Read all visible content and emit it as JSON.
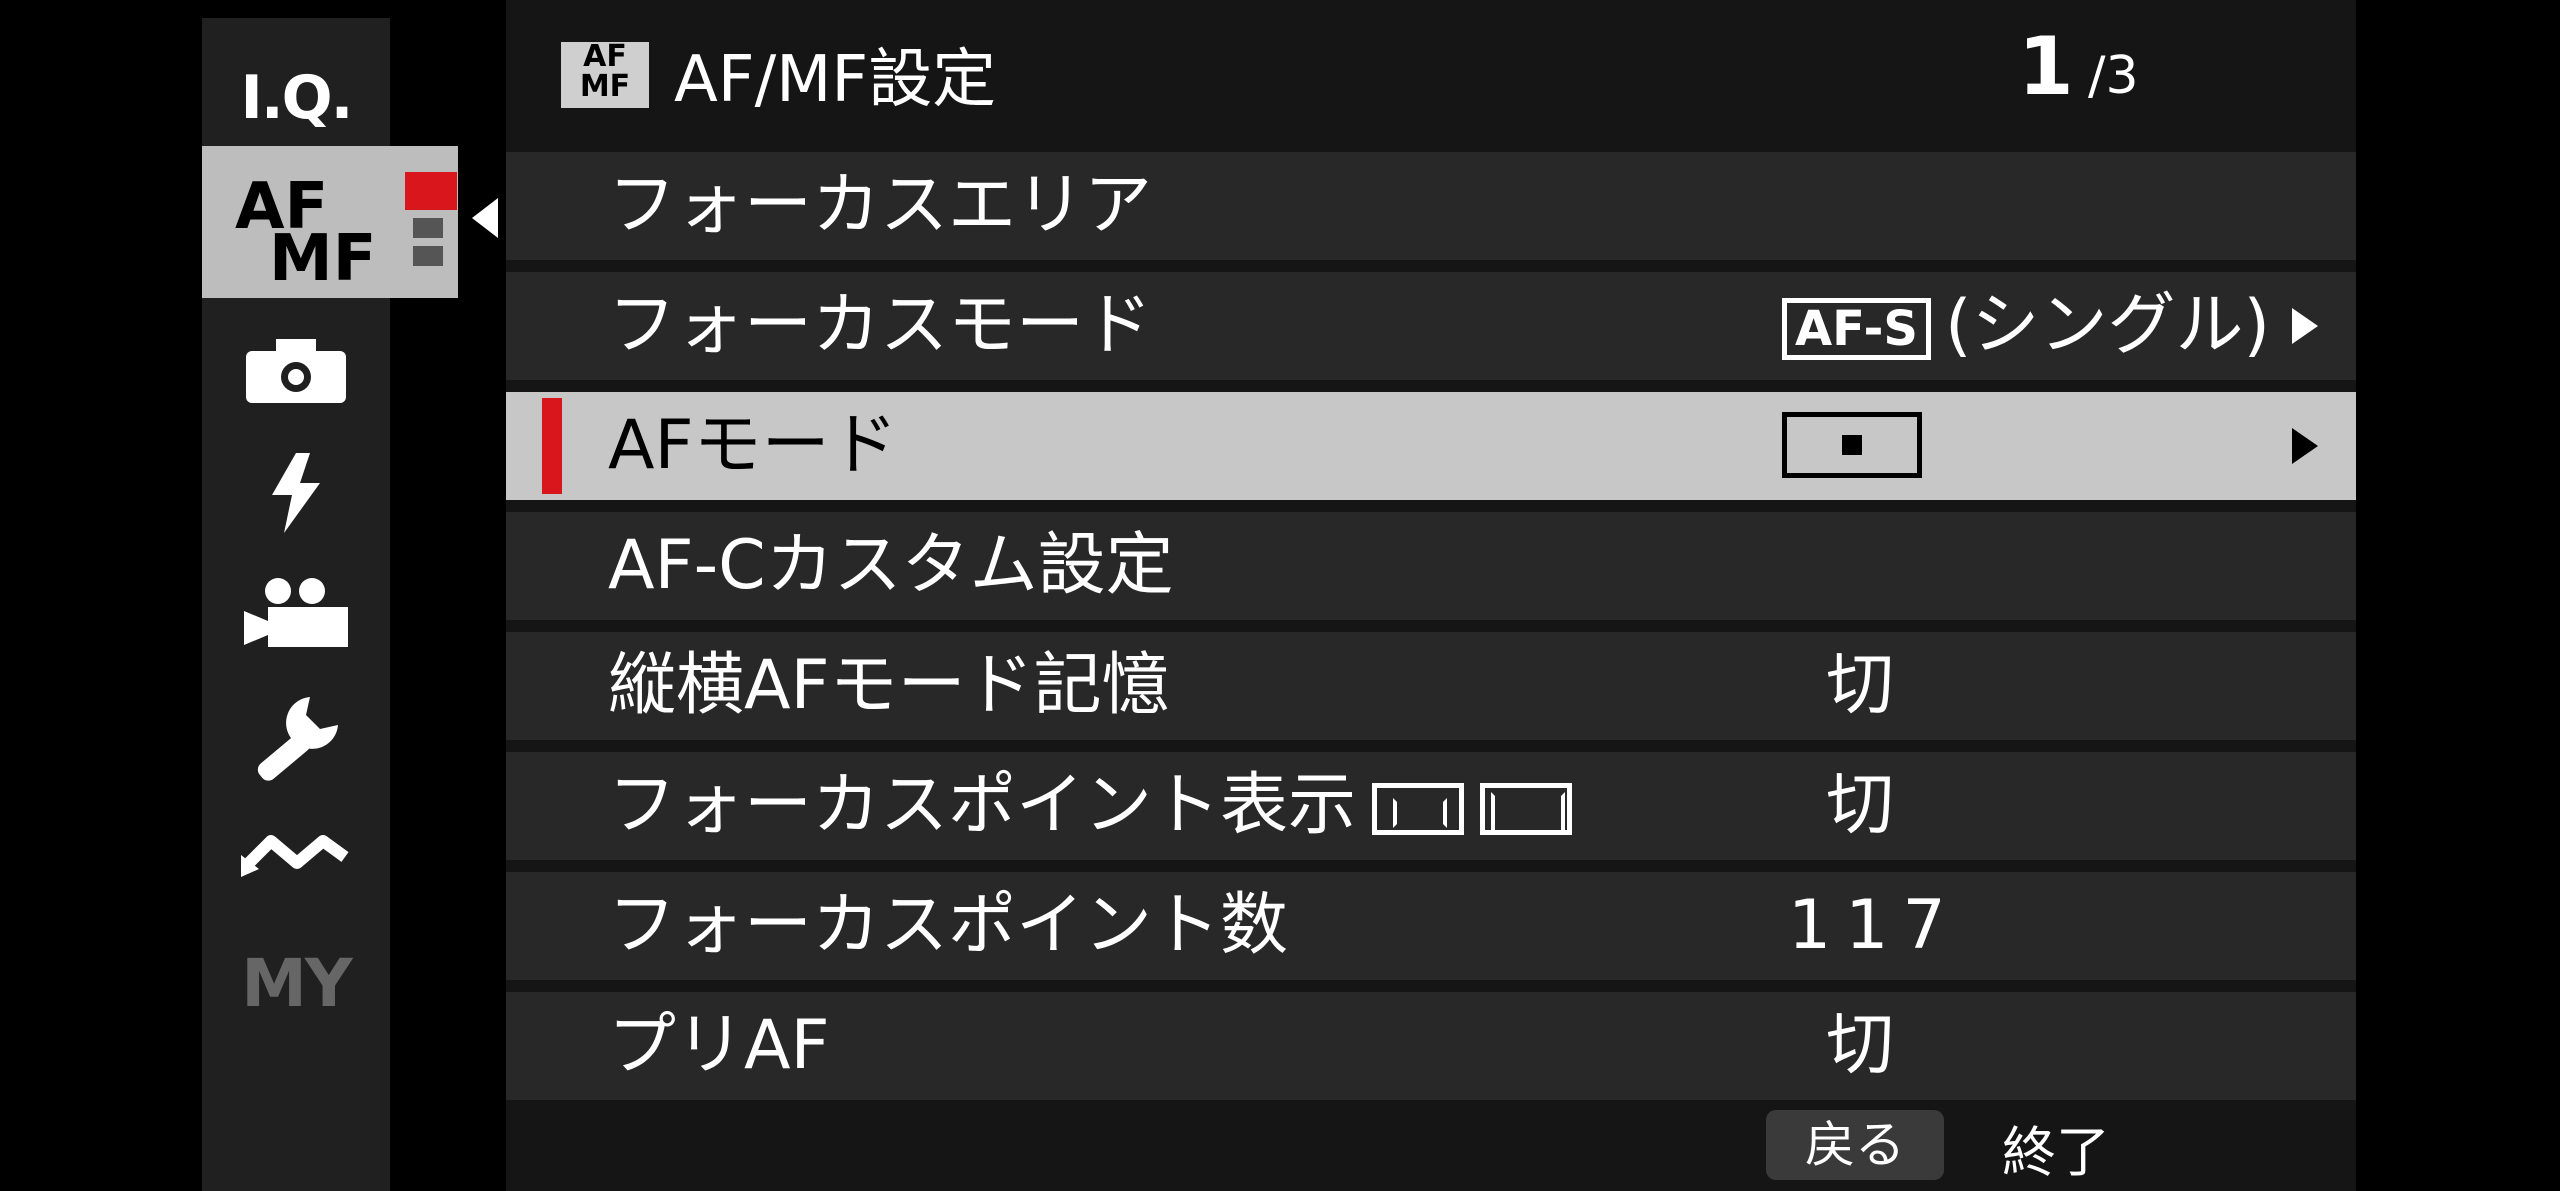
{
  "sidebar": {
    "items": [
      {
        "label": "I.Q.",
        "icon": "iq-text"
      },
      {
        "label_a": "AF",
        "label_b": "MF",
        "icon": "af-mf-tab"
      },
      {
        "icon": "camera-icon"
      },
      {
        "icon": "flash-icon"
      },
      {
        "icon": "movie-icon"
      },
      {
        "icon": "wrench-icon"
      },
      {
        "icon": "wireless-icon"
      },
      {
        "label": "MY",
        "icon": "my-menu-text"
      }
    ]
  },
  "header": {
    "badge_top": "AF",
    "badge_bottom": "MF",
    "title": "AF/MF設定",
    "page_current": "1",
    "page_total": "/3"
  },
  "menu": {
    "items": [
      {
        "label": "フォーカスエリア",
        "value": ""
      },
      {
        "label": "フォーカスモード",
        "value_icon": "AF-S",
        "value": "(シングル)"
      },
      {
        "label": "AFモード",
        "value": ""
      },
      {
        "label": "AF-Cカスタム設定",
        "value": ""
      },
      {
        "label": "縦横AFモード記憶",
        "value": "切"
      },
      {
        "label": "フォーカスポイント表示",
        "value": "切"
      },
      {
        "label": "フォーカスポイント数",
        "value": "117"
      },
      {
        "label": "プリAF",
        "value": "切"
      }
    ]
  },
  "footer": {
    "back_label": "戻る",
    "exit_label": "終了"
  },
  "colors": {
    "accent": "#d8161b",
    "selected_row": "#c7c7c7",
    "row": "#282828",
    "panel": "#151515",
    "sidebar": "#202020"
  }
}
